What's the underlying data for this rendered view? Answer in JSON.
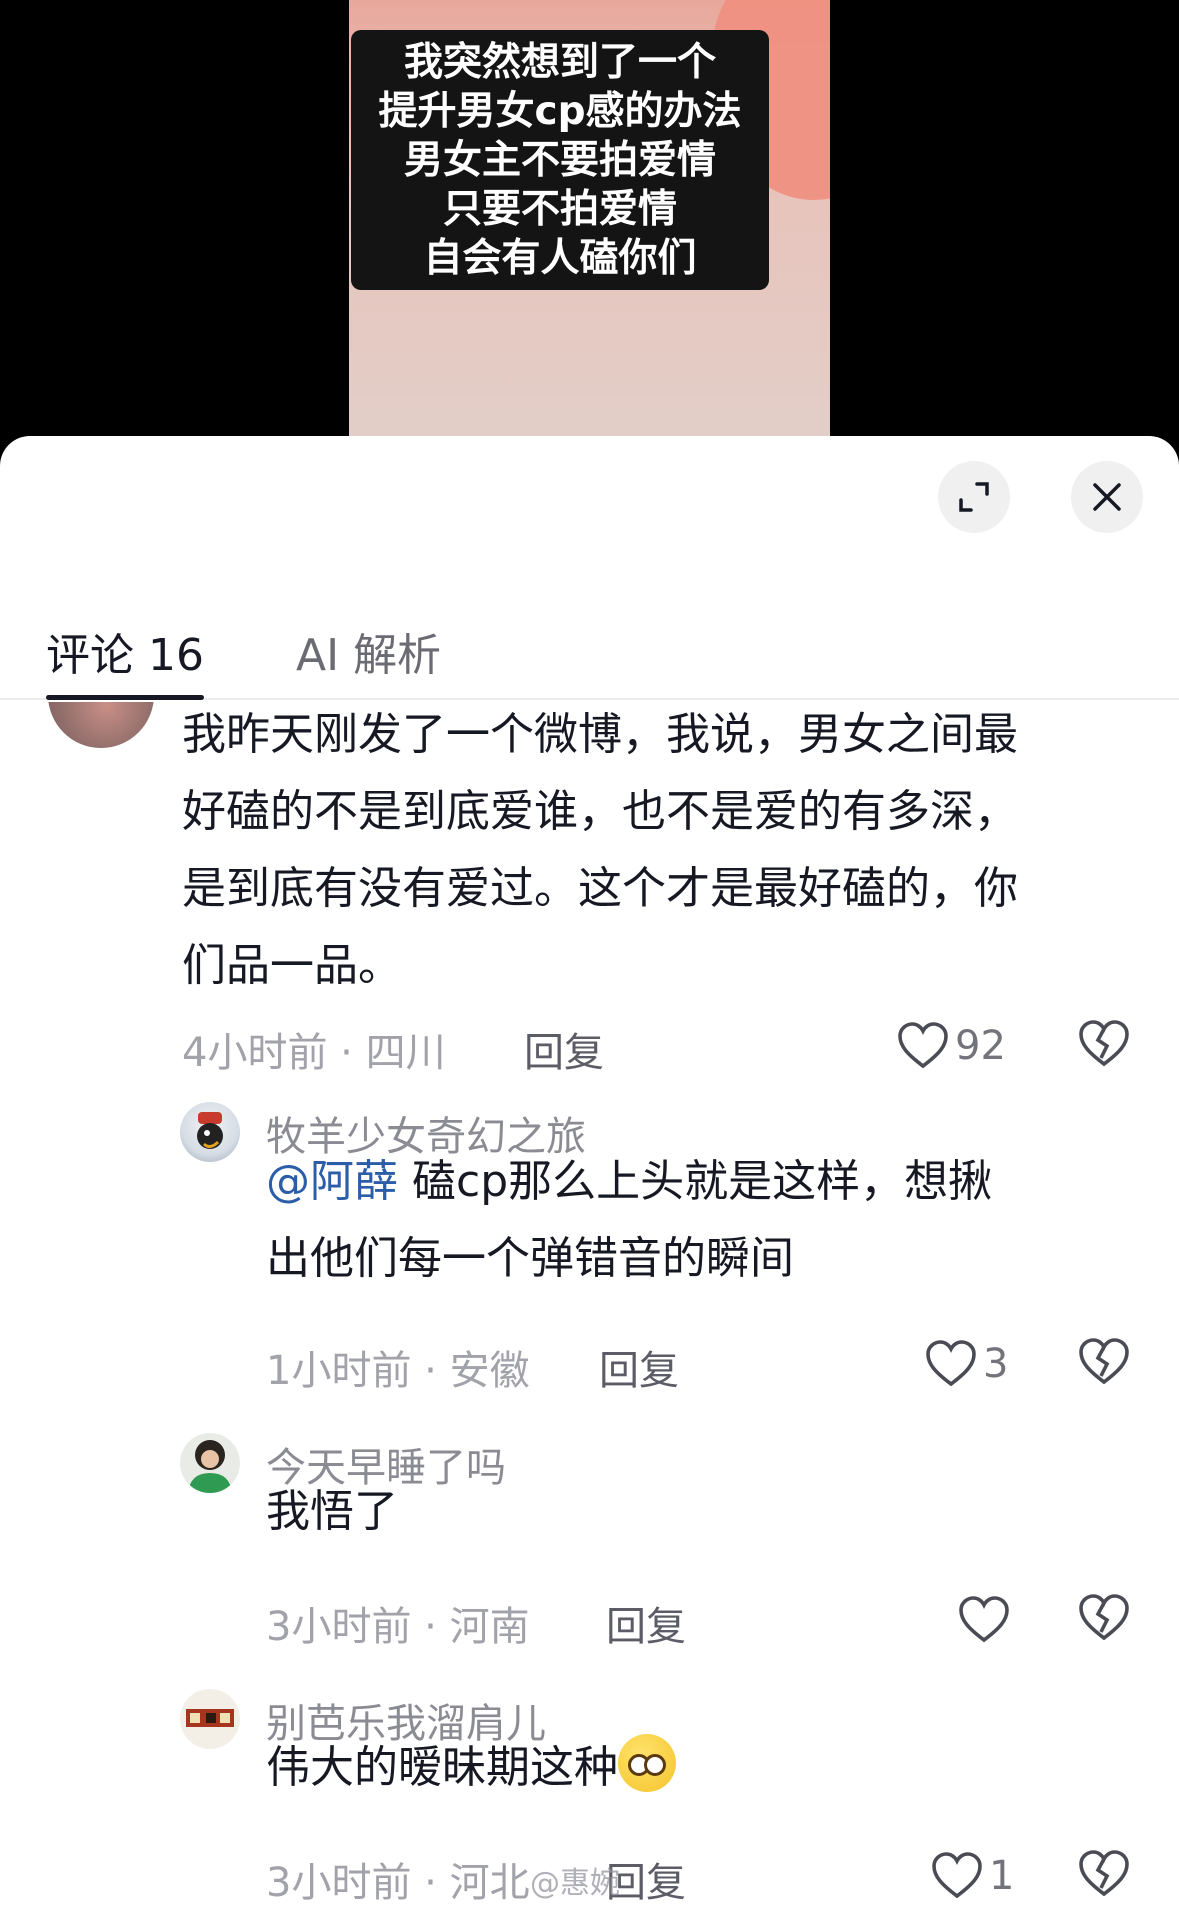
{
  "video": {
    "caption_lines": [
      "我突然想到了一个",
      "提升男女cp感的办法",
      "男女主不要拍爱情",
      "只要不拍爱情",
      "自会有人磕你们"
    ]
  },
  "sheet": {
    "tabs": [
      {
        "label": "评论 16",
        "active": true
      },
      {
        "label": "AI 解析",
        "active": false
      }
    ],
    "expand_icon": "expand-icon",
    "close_icon": "close-icon"
  },
  "comments": [
    {
      "text": "我昨天刚发了一个微博，我说，男女之间最好磕的不是到底爱谁，也不是爱的有多深，是到底有没有爱过。这个才是最好磕的，你们品一品。",
      "text_lines": [
        "我昨天刚发了一个微博，我说，男女之间最",
        "好磕的不是到底爱谁，也不是爱的有多深，",
        "是到底有没有爱过。这个才是最好磕的，你",
        "们品一品。"
      ],
      "meta": "4小时前 · 四川",
      "reply_label": "回复",
      "likes": "92"
    },
    {
      "username": "牧羊少女奇幻之旅",
      "mention": "@阿薛",
      "text_lines": [
        "磕cp那么上头就是这样，想揪",
        "出他们每一个弹错音的瞬间"
      ],
      "meta": "1小时前 · 安徽",
      "reply_label": "回复",
      "likes": "3"
    },
    {
      "username": "今天早睡了吗",
      "text": "我悟了",
      "meta": "3小时前 · 河南",
      "reply_label": "回复",
      "likes": ""
    },
    {
      "username": "别芭乐我溜肩儿",
      "text": "伟大的暧昧期这种",
      "emoji": "pleading-face-emoji",
      "meta": "3小时前 · 河北",
      "reply_label": "回复",
      "likes": "1"
    }
  ],
  "watermark": "@惠婉",
  "colors": {
    "mention": "#2b5da8",
    "text": "#161823",
    "meta": "#a2a2aa"
  }
}
